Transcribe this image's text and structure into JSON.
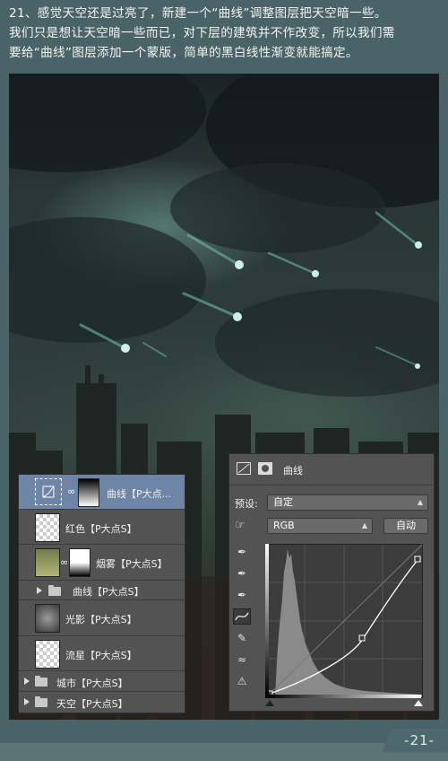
{
  "caption": {
    "line1": "21、感觉天空还是过亮了，新建一个“曲线”调整图层把天空暗一些。",
    "line2": "我们只是想让天空暗一些而已，对下层的建筑并不作改变，所以我们需",
    "line3": "要给“曲线”图层添加一个蒙版，简单的黑白线性渐变就能搞定。"
  },
  "layers_panel": {
    "rows": [
      {
        "name": "曲线【P大点...",
        "selected": true
      },
      {
        "name": "红色【P大点S】"
      },
      {
        "name": "烟雾【P大点S】"
      },
      {
        "name": "曲线【P大点S】"
      },
      {
        "name": "光影【P大点S】"
      },
      {
        "name": "流星【P大点S】"
      },
      {
        "name": "城市【P大点S】"
      },
      {
        "name": "天空【P大点S】"
      }
    ]
  },
  "properties_panel": {
    "title": "曲线",
    "preset_label": "预设:",
    "preset_value": "自定",
    "channel_value": "RGB",
    "auto_button": "自动"
  },
  "page_number": "-21-"
}
